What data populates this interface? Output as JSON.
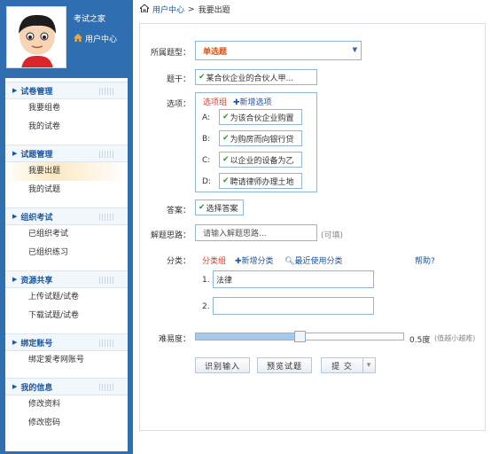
{
  "sidebar": {
    "user_name": "考试之家",
    "user_center": "用户中心",
    "sections": [
      {
        "title": "试卷管理",
        "items": [
          "我要组卷",
          "我的试卷"
        ]
      },
      {
        "title": "试题管理",
        "items": [
          "我要出题",
          "我的试题"
        ]
      },
      {
        "title": "组织考试",
        "items": [
          "已组织考试",
          "已组织练习"
        ]
      },
      {
        "title": "资源共享",
        "items": [
          "上传试题/试卷",
          "下载试题/试卷"
        ]
      },
      {
        "title": "绑定账号",
        "items": [
          "绑定爱考网账号"
        ]
      },
      {
        "title": "我的信息",
        "items": [
          "修改资料",
          "修改密码"
        ]
      }
    ]
  },
  "breadcrumb": {
    "home": "用户中心",
    "sep": ">",
    "current": "我要出题"
  },
  "form": {
    "type_label": "所属题型：",
    "type_value": "单选题",
    "stem_label": "题干：",
    "stem_value": "某合伙企业的合伙人甲...",
    "options_label": "选项：",
    "options_group": "选项组",
    "add_option": "新增选项",
    "options": [
      {
        "letter": "A:",
        "text": "为该合伙企业购置"
      },
      {
        "letter": "B:",
        "text": "为购房而向银行贷"
      },
      {
        "letter": "C:",
        "text": "以企业的设备为乙"
      },
      {
        "letter": "D:",
        "text": "聘请律师办理土地"
      }
    ],
    "answer_label": "答案：",
    "answer_value": "选择答案",
    "analysis_label": "解题思路：",
    "analysis_placeholder": "请输入解题思路...",
    "analysis_optional": "(可填)",
    "category_label": "分类：",
    "category_group": "分类组",
    "add_category": "新增分类",
    "recent_category": "最近使用分类",
    "help": "帮助?",
    "categories": [
      {
        "num": "1.",
        "value": "法律"
      },
      {
        "num": "2.",
        "value": ""
      }
    ],
    "difficulty_label": "难易度：",
    "difficulty_value": 0.5,
    "difficulty_text": "0.5度",
    "difficulty_hint": "(值越小越难)",
    "buttons": {
      "recognize": "识别输入",
      "preview": "预览试题",
      "submit": "提 交",
      "submit_menu": "▾"
    }
  }
}
